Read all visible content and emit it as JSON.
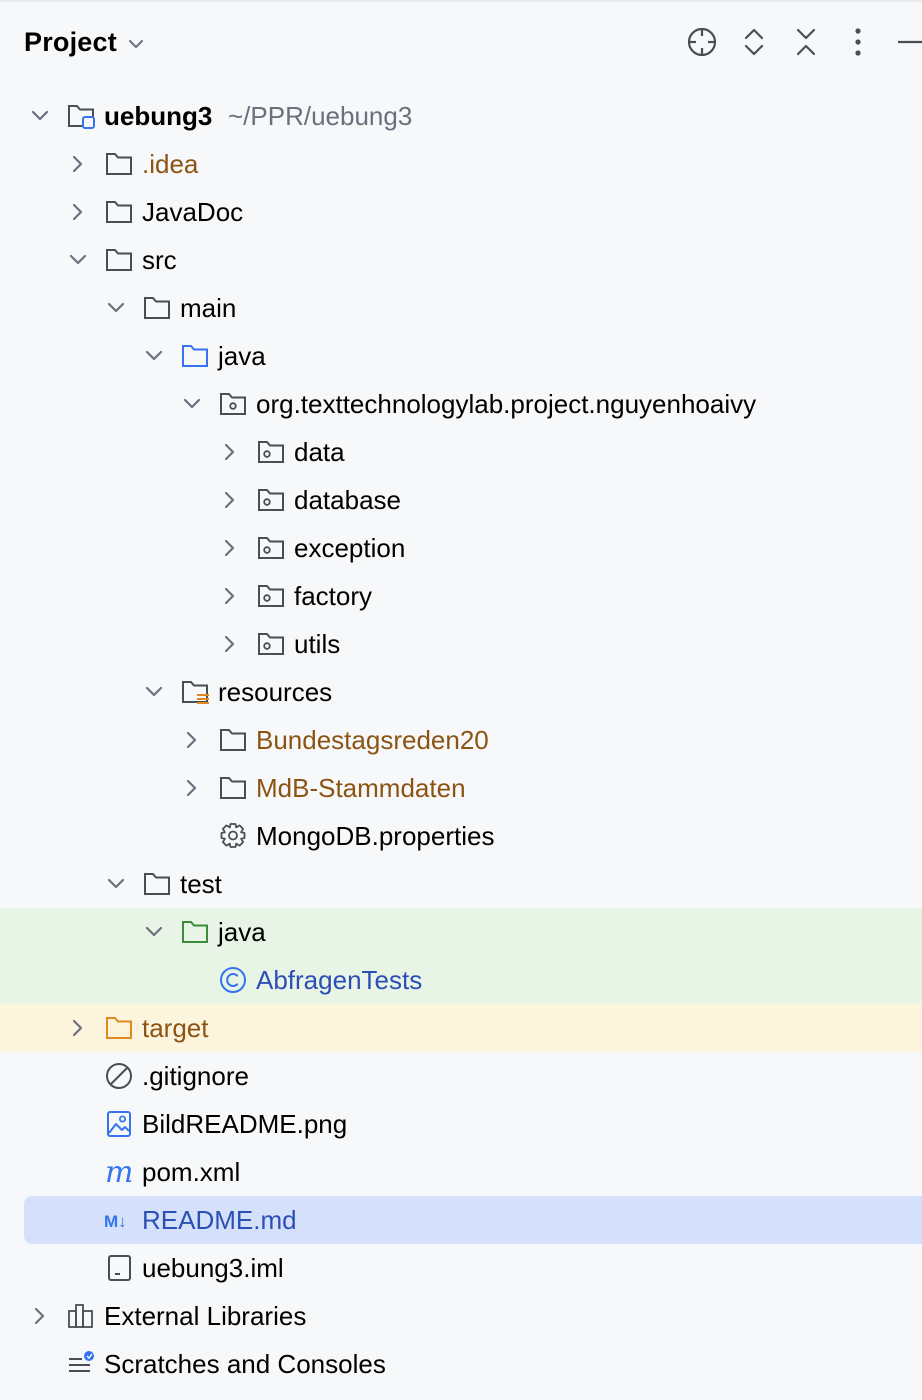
{
  "panel": {
    "title": "Project"
  },
  "colors": {
    "background": "#f7f8fa",
    "test_source_band": "#e8f4e5",
    "excluded_band": "#fdf4de",
    "selection": "#d5e1fa",
    "excluded_text": "#8c5413",
    "class_text": "#2c4fb6"
  },
  "tree": {
    "root": {
      "name": "uebung3",
      "path": "~/PPR/uebung3"
    },
    "idea": ".idea",
    "javadoc": "JavaDoc",
    "src": "src",
    "main": "main",
    "main_java": "java",
    "package": "org.texttechnologylab.project.nguyenhoaivy",
    "pkg_data": "data",
    "pkg_database": "database",
    "pkg_exception": "exception",
    "pkg_factory": "factory",
    "pkg_utils": "utils",
    "resources": "resources",
    "bundestagsreden": "Bundestagsreden20",
    "mdb": "MdB-Stammdaten",
    "mongodb": "MongoDB.properties",
    "test": "test",
    "test_java": "java",
    "abfragen": "AbfragenTests",
    "target": "target",
    "gitignore": ".gitignore",
    "bildreadme": "BildREADME.png",
    "pom": "pom.xml",
    "readme": "README.md",
    "iml": "uebung3.iml",
    "external": "External Libraries",
    "scratches": "Scratches and Consoles"
  }
}
